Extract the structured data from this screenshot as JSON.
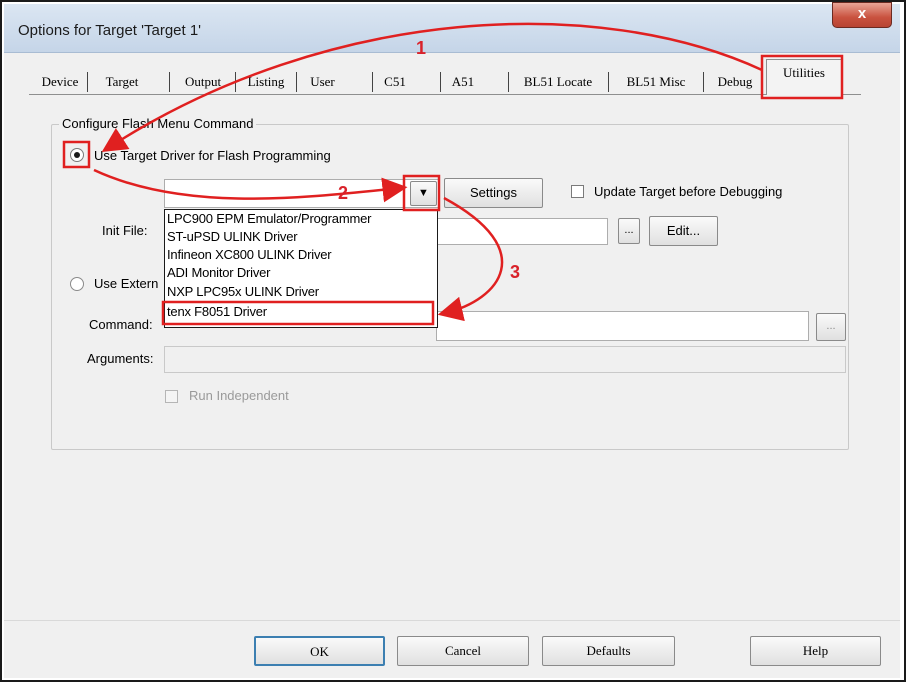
{
  "window": {
    "title": "Options for Target 'Target 1'",
    "close_glyph": "x"
  },
  "tabs": [
    "Device",
    "Target",
    "Output",
    "Listing",
    "User",
    "C51",
    "A51",
    "BL51 Locate",
    "BL51 Misc",
    "Debug",
    "Utilities"
  ],
  "active_tab": "Utilities",
  "group": {
    "label": "Configure Flash Menu Command",
    "use_target_driver_label": "Use Target Driver for Flash Programming",
    "settings_button": "Settings",
    "update_target_label": "Update Target before Debugging",
    "init_file_label": "Init File:",
    "browse_button": "...",
    "edit_button": "Edit...",
    "use_external_label": "Use Extern",
    "command_label": "Command:",
    "arguments_label": "Arguments:",
    "run_independent_label": "Run Independent"
  },
  "dropdown_options": [
    "LPC900 EPM Emulator/Programmer",
    "ST-uPSD ULINK Driver",
    "Infineon XC800 ULINK Driver",
    "ADI Monitor Driver",
    "NXP LPC95x ULINK Driver",
    "tenx F8051 Driver"
  ],
  "highlighted_option": "tenx F8051 Driver",
  "footer": {
    "ok": "OK",
    "cancel": "Cancel",
    "defaults": "Defaults",
    "help": "Help"
  },
  "annotations": {
    "step1": "1",
    "step2": "2",
    "step3": "3",
    "color": "#e02020"
  }
}
